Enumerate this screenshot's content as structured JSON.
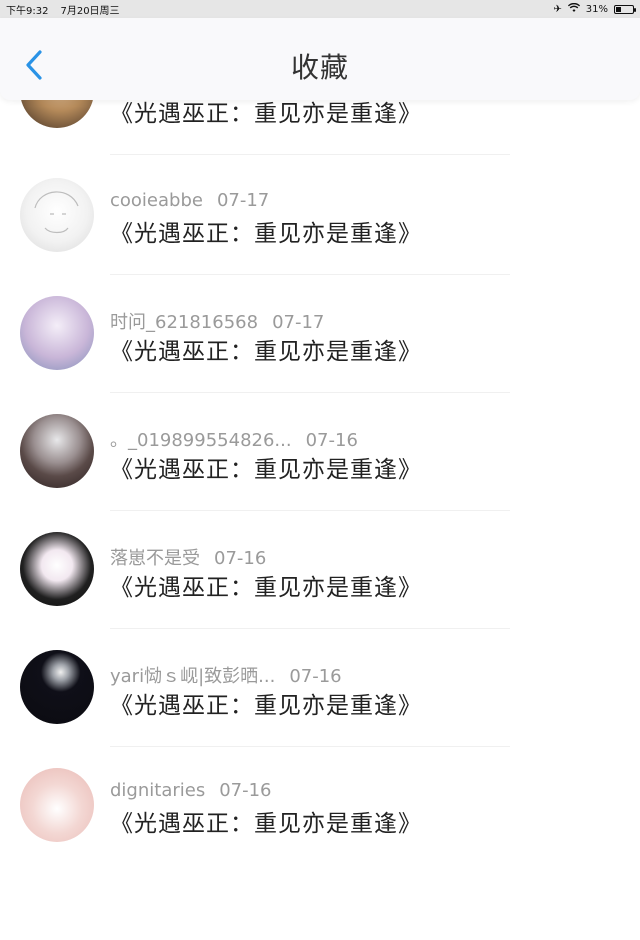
{
  "status_bar": {
    "time": "下午9:32",
    "date": "7月20日周三",
    "battery": "31%",
    "battery_level": 0.31
  },
  "header": {
    "title": "收藏"
  },
  "items": [
    {
      "username": "",
      "date": "",
      "content": "《光遇巫正：重见亦是重逢》"
    },
    {
      "username": "cooieabbe",
      "date": "07-17",
      "content": "《光遇巫正：重见亦是重逢》"
    },
    {
      "username": "时问_621816568",
      "date": "07-17",
      "content": "《光遇巫正：重见亦是重逢》"
    },
    {
      "username": "。_019899554826...",
      "date": "07-16",
      "content": "《光遇巫正：重见亦是重逢》"
    },
    {
      "username": "落崽不是受",
      "date": "07-16",
      "content": "《光遇巫正：重见亦是重逢》"
    },
    {
      "username": "yari恸ｓ岘|致彭晒...",
      "date": "07-16",
      "content": "《光遇巫正：重见亦是重逢》"
    },
    {
      "username": "dignitaries",
      "date": "07-16",
      "content": "《光遇巫正：重见亦是重逢》"
    }
  ],
  "avatar_colors": [
    "#b58a5a",
    "#f2f2f2",
    "#c9b6d8",
    "#5a4a48",
    "#202020",
    "#0f0f18",
    "#f3d7d3"
  ]
}
